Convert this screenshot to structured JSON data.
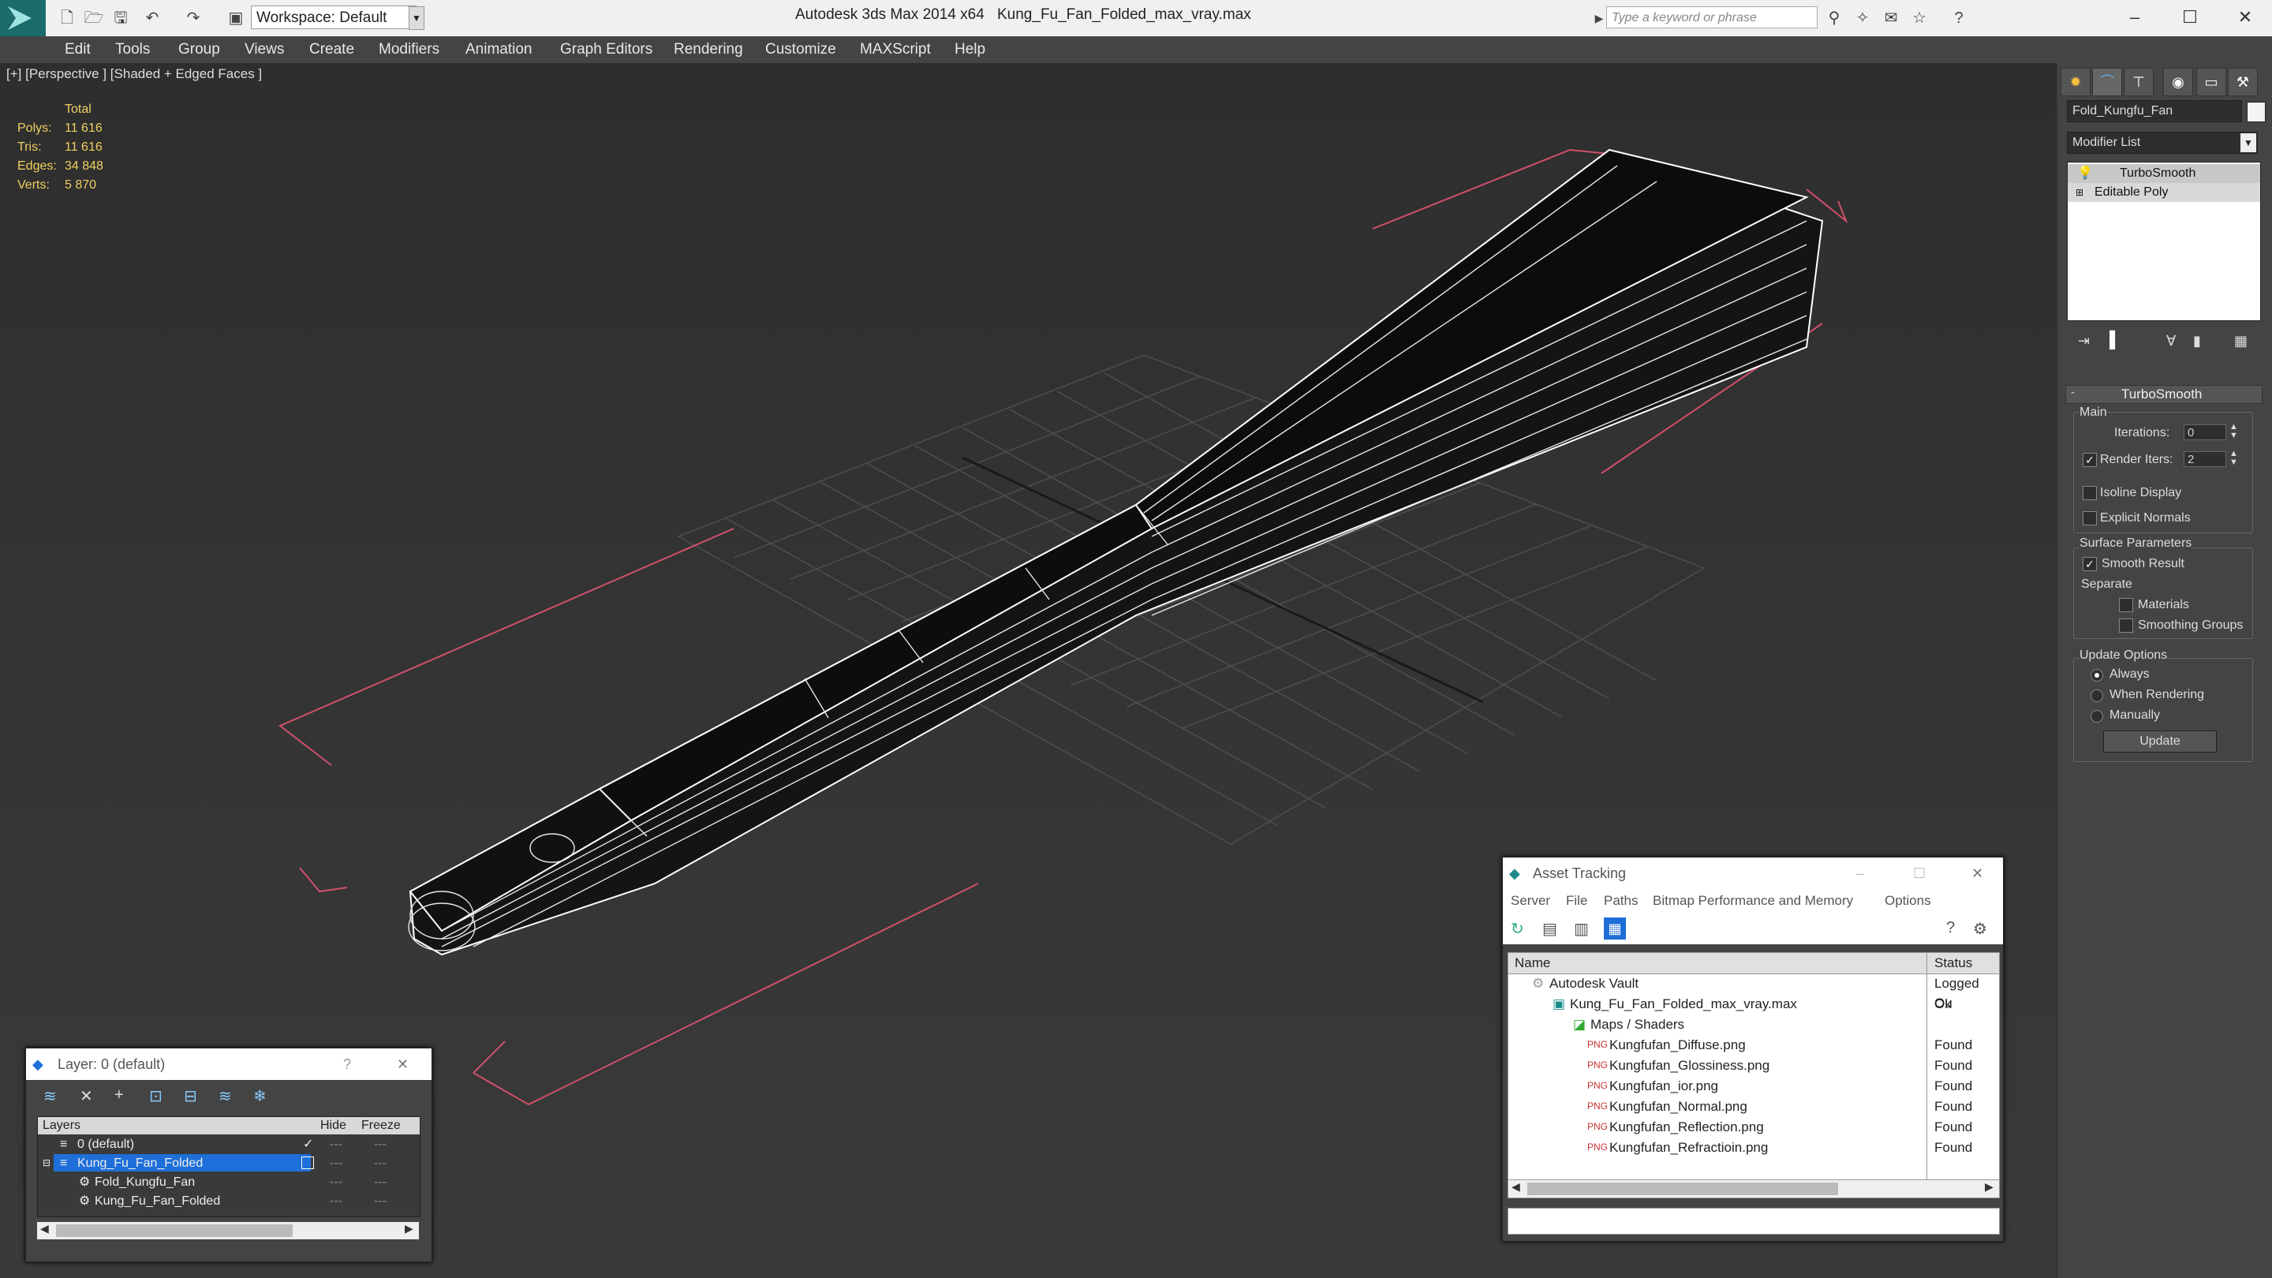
{
  "title_bar": {
    "app_title": "Autodesk 3ds Max  2014 x64",
    "file_name": "Kung_Fu_Fan_Folded_max_vray.max",
    "workspace": "Workspace: Default",
    "search_placeholder": "Type a keyword or phrase"
  },
  "menu": [
    "Edit",
    "Tools",
    "Group",
    "Views",
    "Create",
    "Modifiers",
    "Animation",
    "Graph Editors",
    "Rendering",
    "Customize",
    "MAXScript",
    "Help"
  ],
  "viewport": {
    "label": "[+] [Perspective ] [Shaded + Edged Faces ]",
    "stats": {
      "header": "Total",
      "rows": [
        {
          "label": "Polys:",
          "value": "11 616"
        },
        {
          "label": "Tris:",
          "value": "11 616"
        },
        {
          "label": "Edges:",
          "value": "34 848"
        },
        {
          "label": "Verts:",
          "value": "5 870"
        }
      ]
    }
  },
  "command_panel": {
    "object_name": "Fold_Kungfu_Fan",
    "modifier_list": "Modifier List",
    "stack": [
      "TurboSmooth",
      "Editable Poly"
    ],
    "rollout_title": "TurboSmooth",
    "main_label": "Main",
    "iterations_label": "Iterations:",
    "iterations_value": "0",
    "render_iters_label": "Render Iters:",
    "render_iters_value": "2",
    "isoline_label": "Isoline Display",
    "explicit_normals_label": "Explicit Normals",
    "surface_params_label": "Surface Parameters",
    "smooth_result_label": "Smooth Result",
    "separate_label": "Separate",
    "materials_label": "Materials",
    "smoothing_groups_label": "Smoothing Groups",
    "update_options_label": "Update Options",
    "always_label": "Always",
    "when_rendering_label": "When Rendering",
    "manually_label": "Manually",
    "update_button": "Update"
  },
  "layer_dialog": {
    "title": "Layer: 0 (default)",
    "help": "?",
    "columns": [
      "Layers",
      "Hide",
      "Freeze"
    ],
    "rows": [
      "0 (default)",
      "Kung_Fu_Fan_Folded",
      "Fold_Kungfu_Fan",
      "Kung_Fu_Fan_Folded"
    ]
  },
  "asset_dialog": {
    "title": "Asset Tracking",
    "menu": [
      "Server",
      "File",
      "Paths",
      "Bitmap Performance and Memory",
      "Options"
    ],
    "columns": [
      "Name",
      "Status"
    ],
    "rows": [
      {
        "name": "Autodesk Vault",
        "status": "Logged Ou"
      },
      {
        "name": "Kung_Fu_Fan_Folded_max_vray.max",
        "status": "Ok"
      },
      {
        "name": "Maps / Shaders",
        "status": ""
      },
      {
        "name": "Kungfufan_Diffuse.png",
        "status": "Found"
      },
      {
        "name": "Kungfufan_Glossiness.png",
        "status": "Found"
      },
      {
        "name": "Kungfufan_ior.png",
        "status": "Found"
      },
      {
        "name": "Kungfufan_Normal.png",
        "status": "Found"
      },
      {
        "name": "Kungfufan_Reflection.png",
        "status": "Found"
      },
      {
        "name": "Kungfufan_Refractioin.png",
        "status": "Found"
      }
    ]
  },
  "colors": {
    "accent": "#1e6fd9",
    "selection_box": "#d0506a",
    "stat_text": "#f0d060"
  }
}
